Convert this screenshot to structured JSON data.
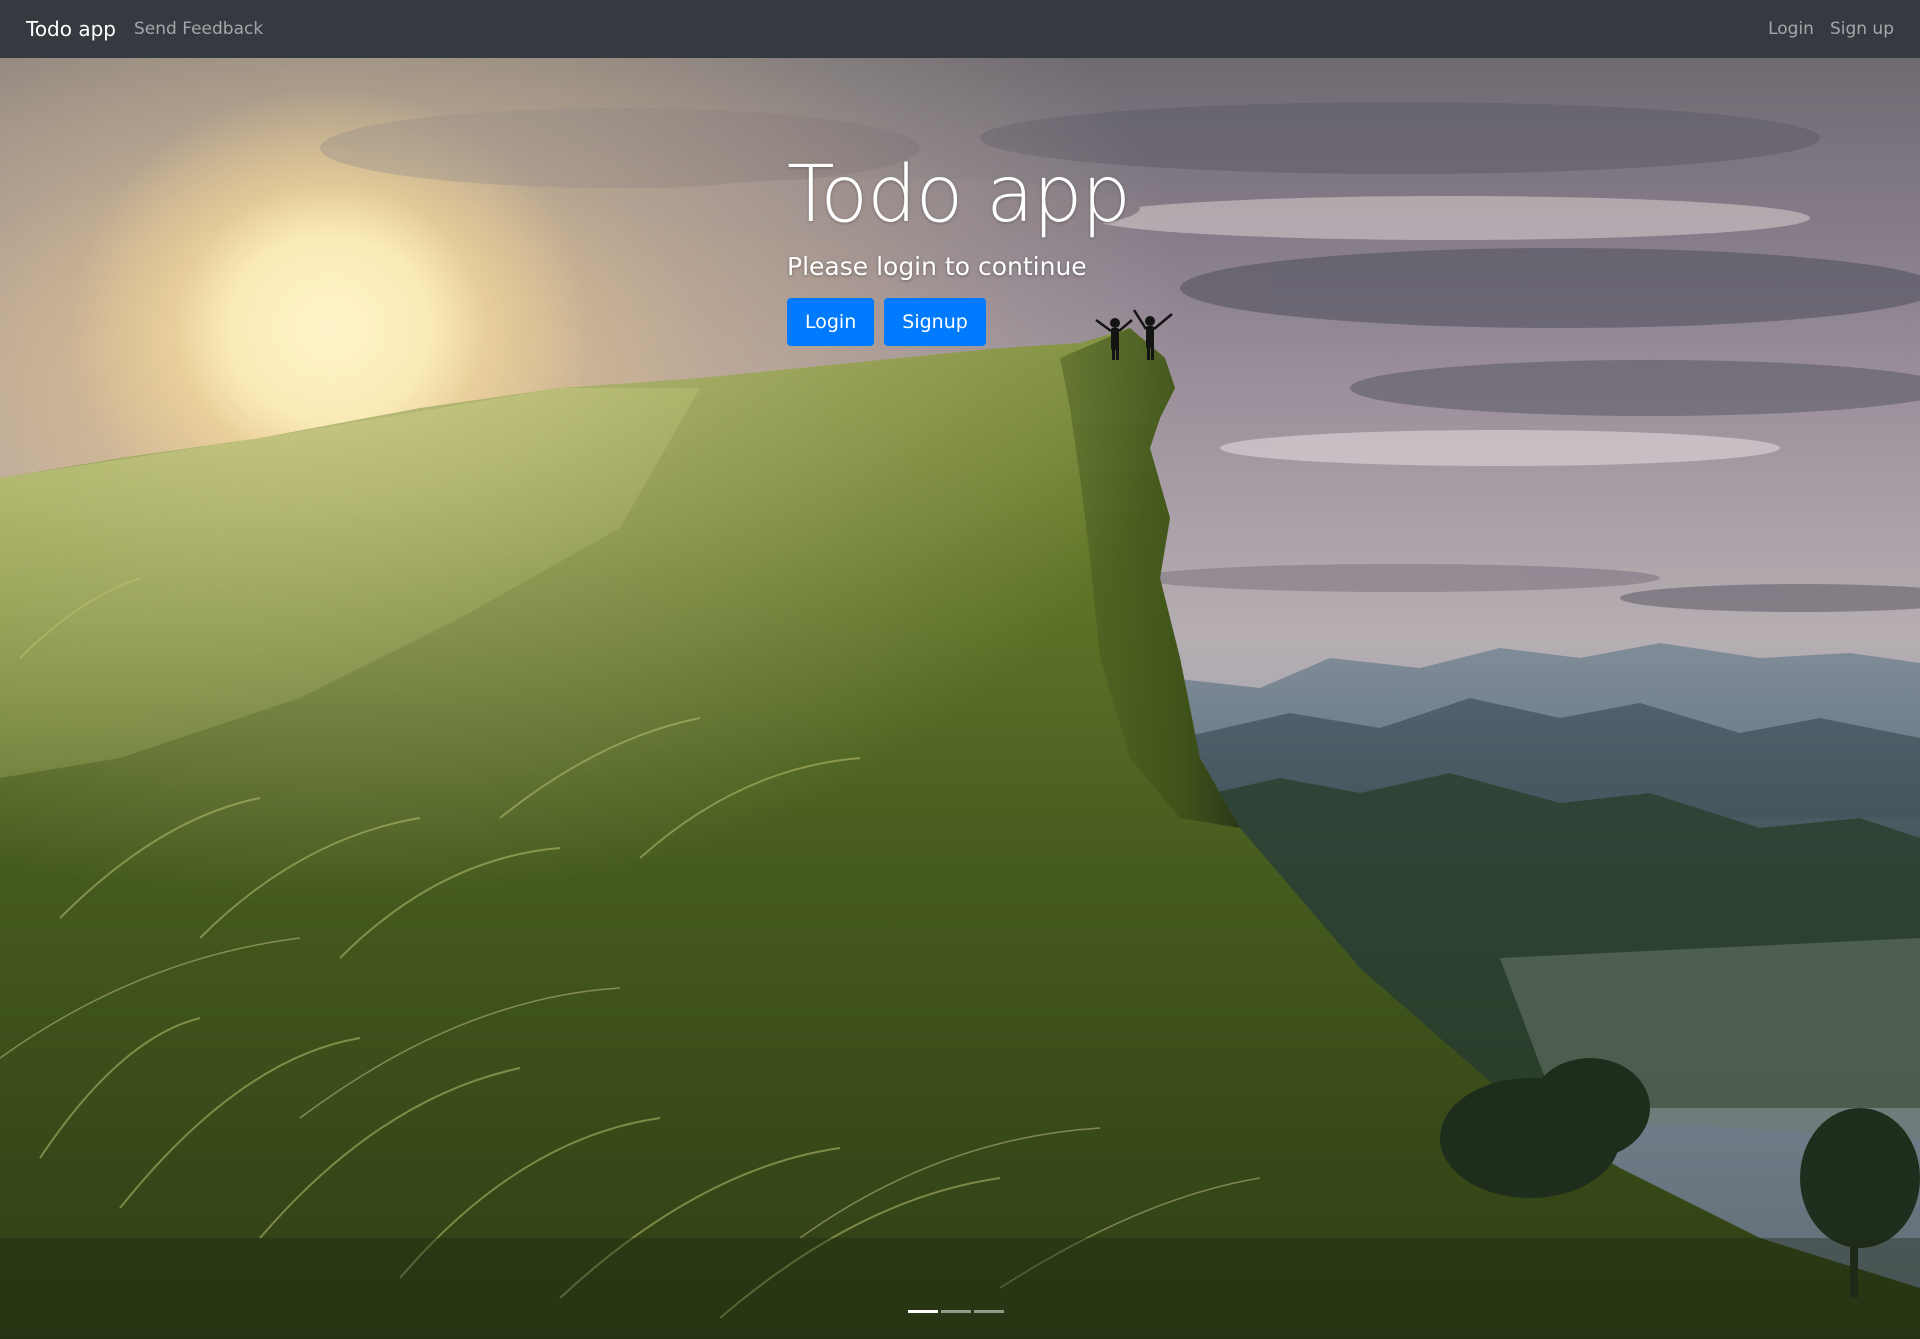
{
  "navbar": {
    "brand": "Todo app",
    "left_links": [
      {
        "label": "Send Feedback"
      }
    ],
    "right_links": [
      {
        "label": "Login"
      },
      {
        "label": "Sign up"
      }
    ],
    "background_color": "#343a40"
  },
  "hero": {
    "title": "Todo app",
    "subtitle": "Please login to continue",
    "buttons": [
      {
        "label": "Login"
      },
      {
        "label": "Signup"
      }
    ],
    "button_color": "#007bff",
    "background_image": "mountain-cliff-sunset-photo"
  },
  "carousel": {
    "slide_count": 3,
    "active_index": 0
  }
}
